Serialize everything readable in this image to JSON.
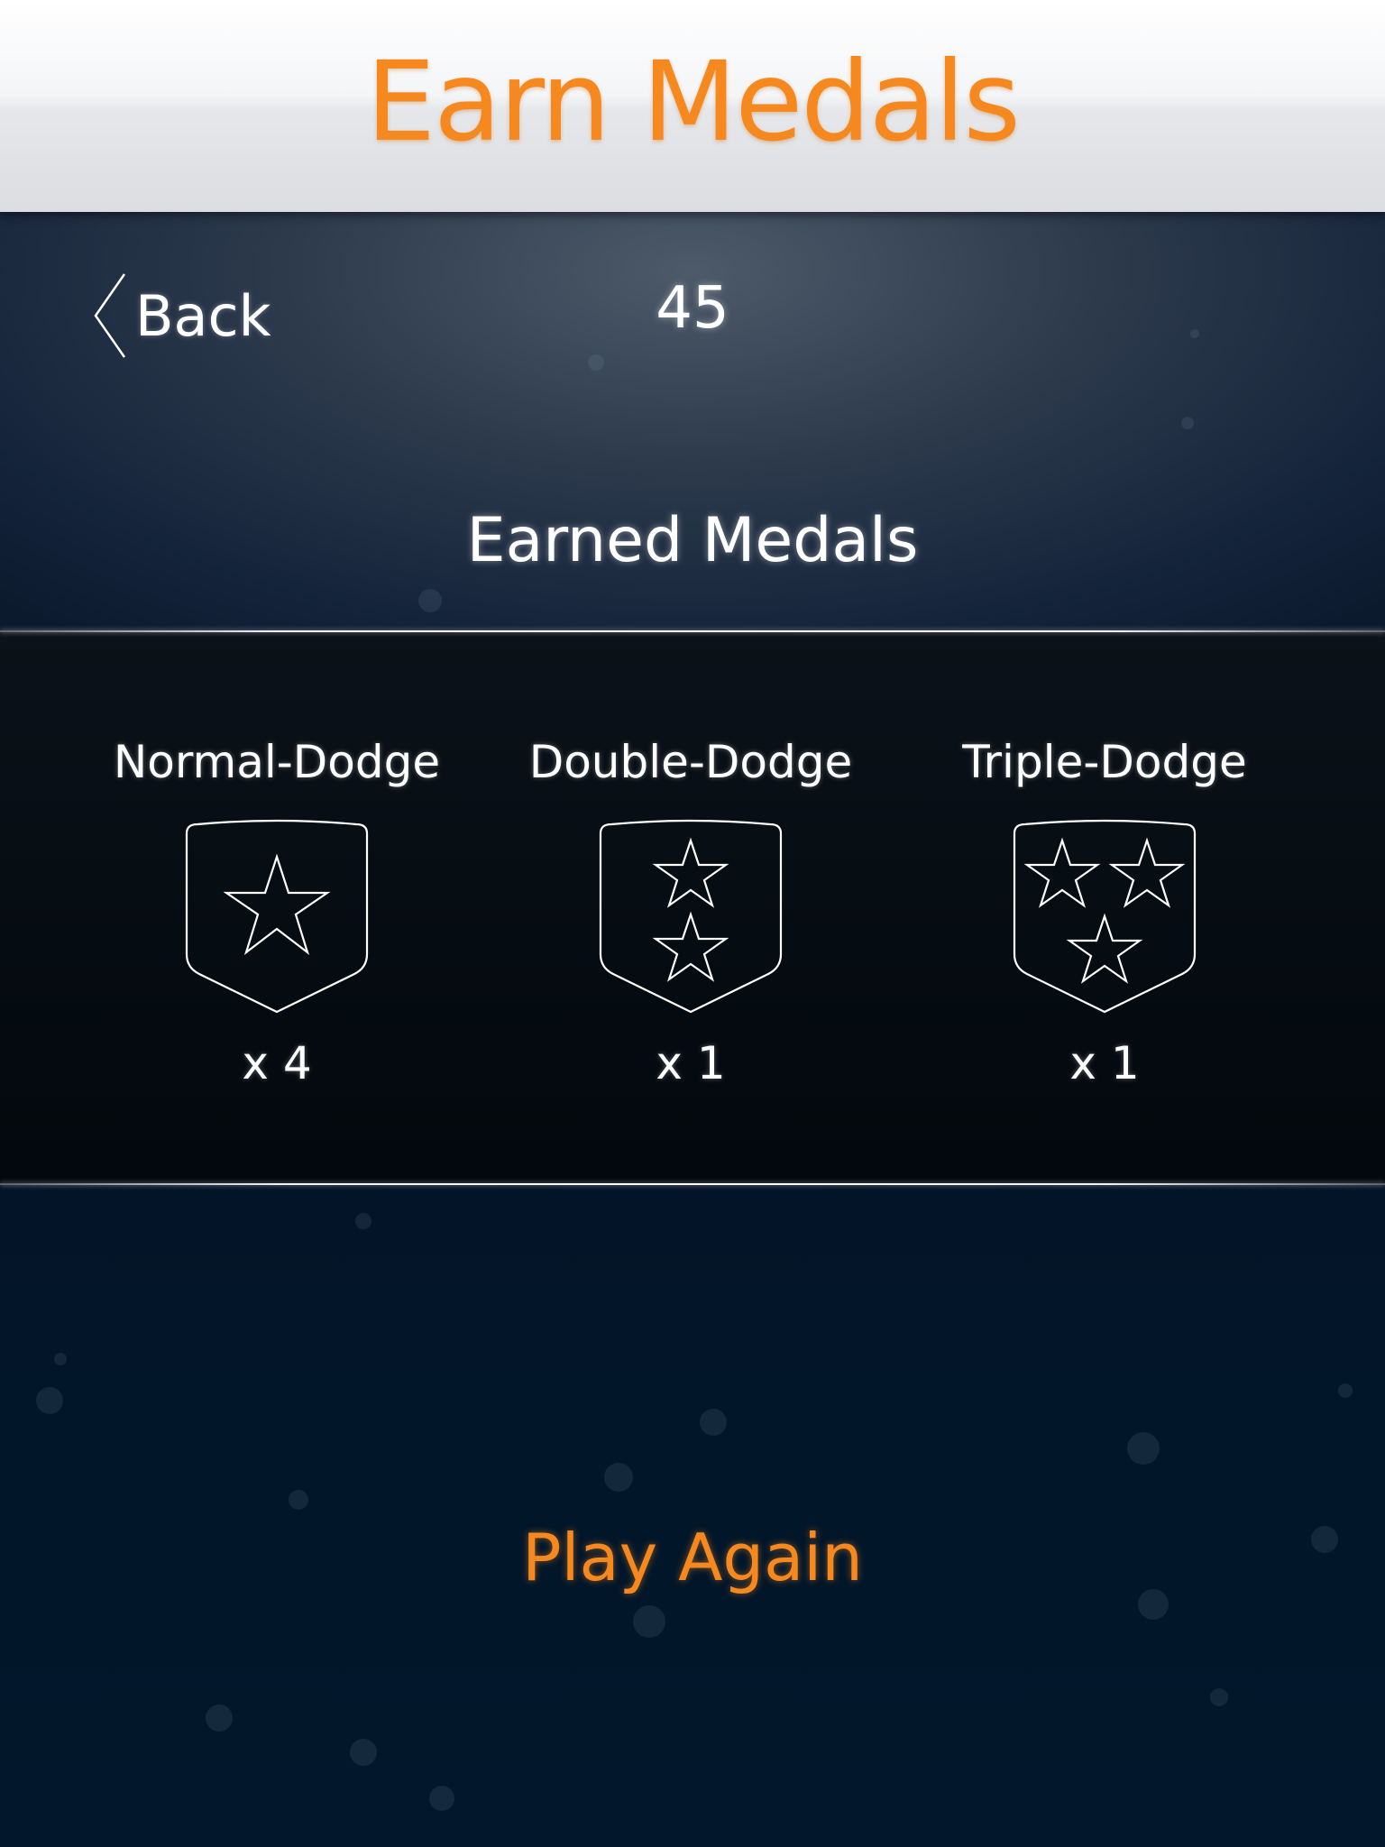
{
  "header": {
    "title": "Earn Medals"
  },
  "top_bar": {
    "back_label": "Back",
    "score": "45"
  },
  "medals_section": {
    "title": "Earned Medals",
    "medals": [
      {
        "name": "Normal-Dodge",
        "count": "x 4",
        "stars": 1,
        "icon": "shield-one-star-icon"
      },
      {
        "name": "Double-Dodge",
        "count": "x 1",
        "stars": 2,
        "icon": "shield-two-stars-icon"
      },
      {
        "name": "Triple-Dodge",
        "count": "x 1",
        "stars": 3,
        "icon": "shield-three-stars-icon"
      }
    ]
  },
  "actions": {
    "play_again_label": "Play Again"
  },
  "colors": {
    "accent_orange": "#f5891f",
    "text_white": "#ffffff",
    "background_navy": "#0c1a2e"
  }
}
